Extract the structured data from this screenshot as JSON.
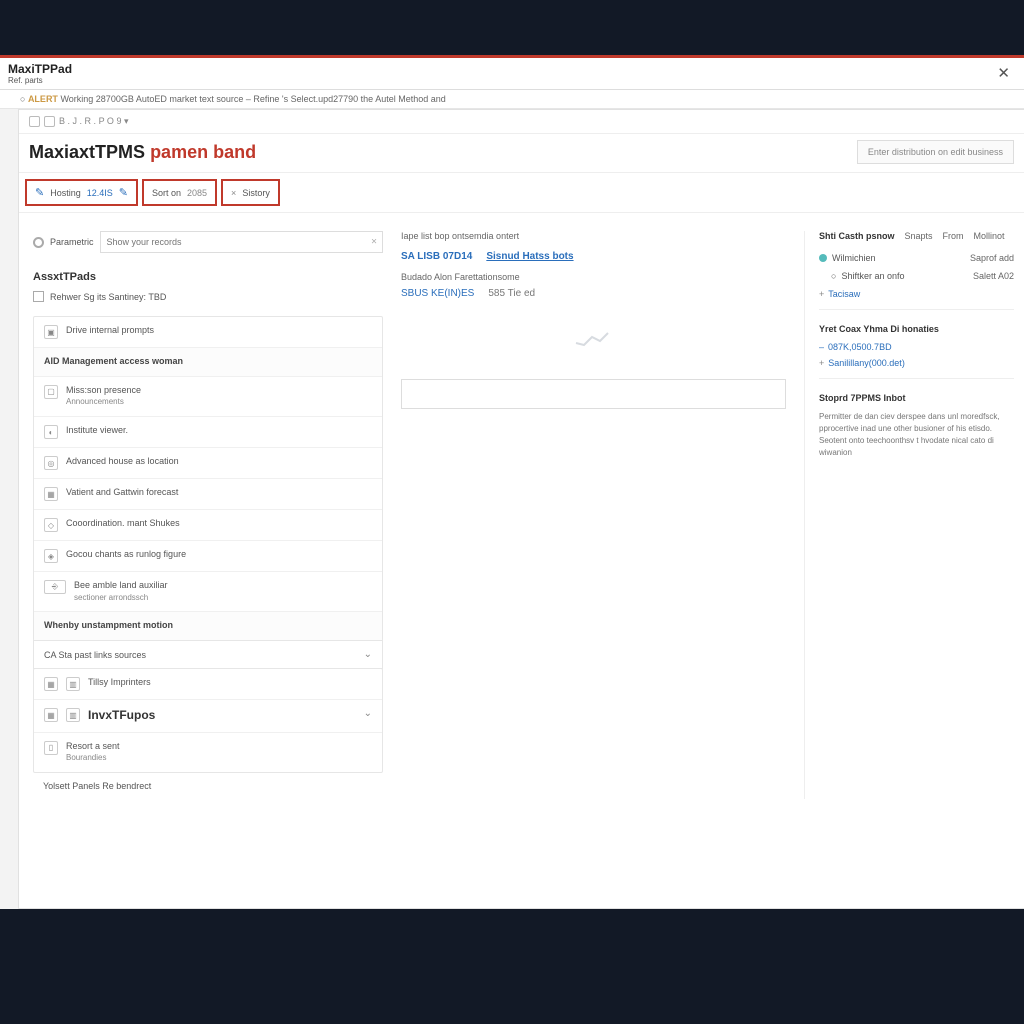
{
  "window": {
    "title": "MaxiTPPad",
    "subtitle": "Ref. parts",
    "close": "✕"
  },
  "notice": {
    "warn": "ALERT",
    "text": "Working 28700GB AutoED market text source – Refine 's Select.upd27790 the Autel Method and"
  },
  "crumbs": [
    "B",
    "J",
    "R",
    "P",
    "O",
    "9"
  ],
  "page": {
    "title_black": "MaxiaxtTPMS",
    "title_red": "pamen band",
    "header_action": "Enter distribution on edit business"
  },
  "tabs": [
    {
      "icon": "✎",
      "label": "Hosting",
      "link": "12.4IS"
    },
    {
      "label": "Sort on",
      "value": "2085"
    },
    {
      "prefix": "×",
      "label": "Sistory"
    }
  ],
  "search": {
    "radio_label": "Parametric",
    "placeholder": "Show your records"
  },
  "left": {
    "section": "AssxtTPads",
    "check": "Rehwer Sg its Santiney:  TBD",
    "items": [
      {
        "icon": "▣",
        "label": "Drive internal prompts"
      },
      {
        "type": "subhead",
        "label": "AID Management access    woman"
      },
      {
        "icon": "▢",
        "label": "Miss:son presence",
        "sub": "Announcements"
      },
      {
        "icon": "◐",
        "label": "Institute viewer."
      },
      {
        "icon": "◎",
        "label": "Advanced house as location"
      },
      {
        "icon": "▦",
        "label": "Vatient and Gattwin forecast"
      },
      {
        "icon": "◇",
        "label": "Cooordination.    mant Shukes"
      },
      {
        "icon": "◈",
        "label": "Gocou chants as runlog figure"
      },
      {
        "icon": "⎆",
        "wide": true,
        "label": "Bee amble land auxiliar",
        "sub": "sectioner arrondssch"
      },
      {
        "type": "subhead",
        "label": "Whenby unstampment motion"
      }
    ],
    "expander1": "CA Sta past links sources",
    "row_items": [
      {
        "icons": 2,
        "label": "Tillsy Imprinters"
      },
      {
        "icons": 2,
        "label": "InvxTFupos",
        "bold": true,
        "chev": true
      }
    ],
    "last_item": {
      "icon": "▯",
      "label": "Resort a sent",
      "sub": "Bourandies"
    },
    "footer": "Yolsett Panels Re bendrect"
  },
  "mid": {
    "heading": "Iape list bop ontsemdia ontert",
    "links": [
      "SA LISB 07D14",
      "Sisnud Hatss bots"
    ],
    "sub": "Budado Alon Farettationsome",
    "sub2_blue": "SBUS KE(IN)ES",
    "sub2_gray": "585 Tie ed"
  },
  "right": {
    "tabs": [
      "Shti Casth psnow",
      "Snapts",
      "From",
      "Mollinot"
    ],
    "w_label": "Wilmichien",
    "w_value": "Saprof add",
    "w_sub": "Shiftker an onfo",
    "w_sub_value": "Salett A02",
    "w_link": "Tacisaw",
    "section2": "Yret Coax Yhma Di honaties",
    "item2a": "087K,0500.7BD",
    "item2b": "Sanilillany(000.det)",
    "section3": "Stoprd 7PPMS Inbot",
    "paragraph": "Permitter de dan ciev derspee dans unl moredfsck, pprocertive inad une other busioner of his etisdo. Seotent onto teechoonthsv t hvodate nical cato di wiwanion"
  }
}
